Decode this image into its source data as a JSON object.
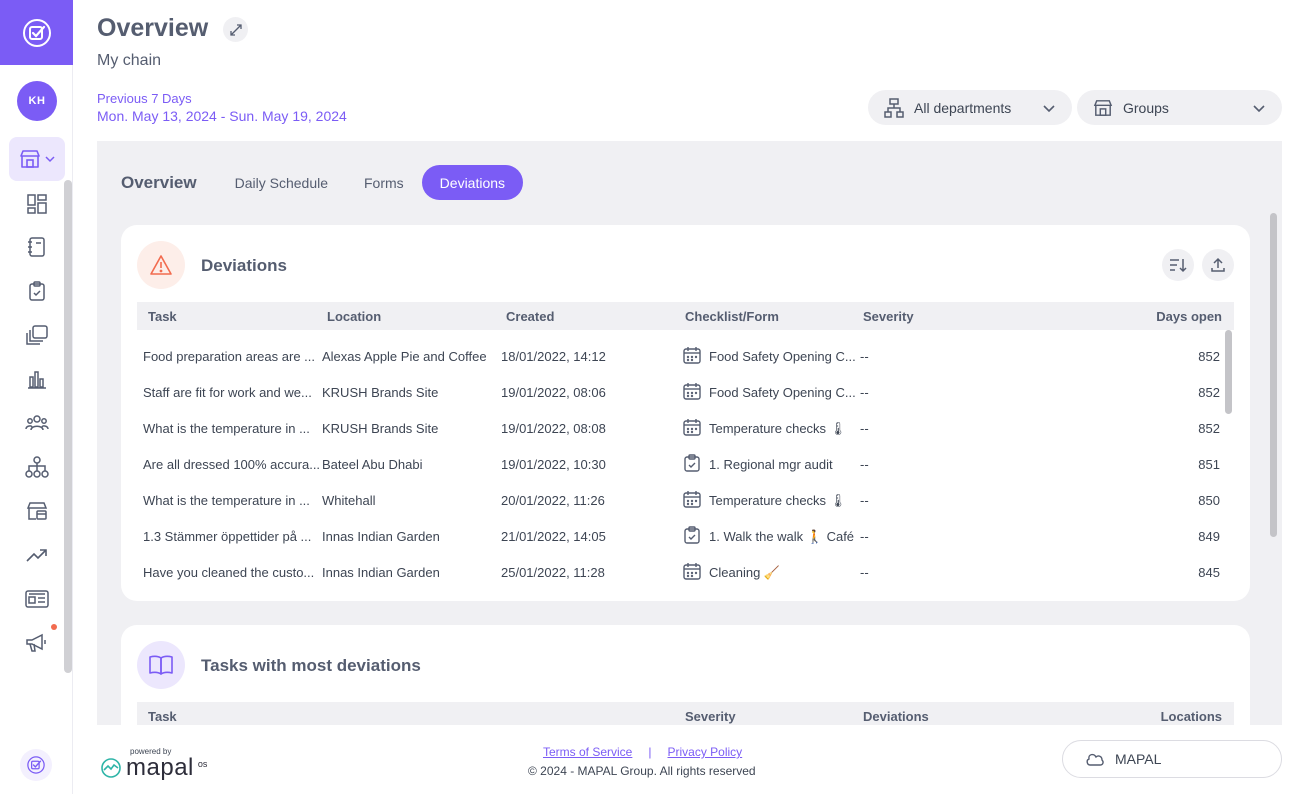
{
  "header": {
    "title": "Overview",
    "subtitle": "My chain",
    "period_label": "Previous 7 Days",
    "period_range": "Mon. May 13, 2024 - Sun. May 19, 2024"
  },
  "sidebar": {
    "avatar_initials": "KH",
    "icons": [
      "dashboard-icon",
      "logbook-icon",
      "clipboard-icon",
      "library-icon",
      "bar-chart-icon",
      "people-icon",
      "hierarchy-icon",
      "store-calendar-icon",
      "trend-icon",
      "newspaper-icon",
      "megaphone-icon"
    ]
  },
  "filters": {
    "departments": "All departments",
    "groups": "Groups"
  },
  "tabs": {
    "overview": "Overview",
    "items": [
      "Daily Schedule",
      "Forms",
      "Deviations"
    ],
    "active": "Deviations"
  },
  "deviations": {
    "title": "Deviations",
    "columns": [
      "Task",
      "Location",
      "Created",
      "Checklist/Form",
      "Severity",
      "Days open"
    ],
    "rows": [
      {
        "task": "Food preparation areas are ...",
        "location": "Alexas Apple Pie and Coffee",
        "created": "18/01/2022, 14:12",
        "checklist": "Food Safety Opening C...",
        "checklist_icon": "calendar",
        "severity": "--",
        "days": "852"
      },
      {
        "task": "Staff are fit for work and we...",
        "location": "KRUSH Brands Site",
        "created": "19/01/2022, 08:06",
        "checklist": "Food Safety Opening C...",
        "checklist_icon": "calendar",
        "severity": "--",
        "days": "852"
      },
      {
        "task": "What is the temperature in ...",
        "location": "KRUSH Brands Site",
        "created": "19/01/2022, 08:08",
        "checklist": "Temperature checks 🌡",
        "checklist_icon": "calendar",
        "severity": "--",
        "days": "852"
      },
      {
        "task": "Are all dressed 100% accura...",
        "location": "Bateel Abu Dhabi",
        "created": "19/01/2022, 10:30",
        "checklist": "1. Regional mgr audit",
        "checklist_icon": "clipboard",
        "severity": "--",
        "days": "851"
      },
      {
        "task": "What is the temperature in ...",
        "location": "Whitehall",
        "created": "20/01/2022, 11:26",
        "checklist": "Temperature checks 🌡",
        "checklist_icon": "calendar",
        "severity": "--",
        "days": "850"
      },
      {
        "task": "1.3 Stämmer öppettider på ...",
        "location": "Innas Indian Garden",
        "created": "21/01/2022, 14:05",
        "checklist": "1. Walk the walk 🚶 Café",
        "checklist_icon": "clipboard",
        "severity": "--",
        "days": "849"
      },
      {
        "task": "Have you cleaned the custo...",
        "location": "Innas Indian Garden",
        "created": "25/01/2022, 11:28",
        "checklist": "Cleaning 🧹",
        "checklist_icon": "calendar",
        "severity": "--",
        "days": "845"
      }
    ]
  },
  "tasks_most": {
    "title": "Tasks with most deviations",
    "columns": [
      "Task",
      "Severity",
      "Deviations",
      "Locations"
    ]
  },
  "footer": {
    "powered_by": "powered by",
    "brand": "mapal",
    "brand_suffix": "os",
    "terms": "Terms of Service",
    "separator": "|",
    "privacy": "Privacy Policy",
    "copyright": "© 2024 - MAPAL Group. All rights reserved",
    "mapal_button": "MAPAL"
  },
  "colors": {
    "accent": "#7b5cf5",
    "warning": "#f26b4f",
    "panel_bg": "#f0f0f3"
  }
}
